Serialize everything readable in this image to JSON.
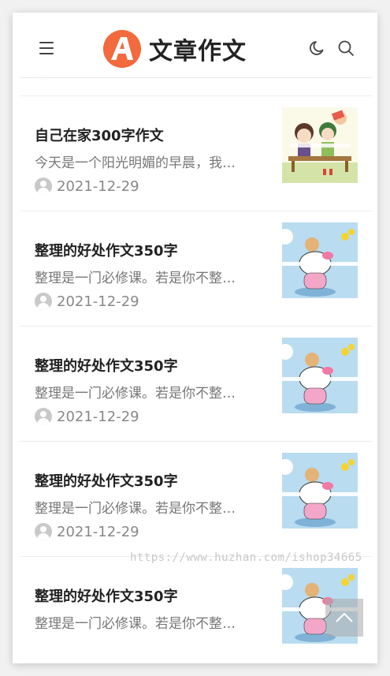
{
  "header": {
    "logo_text": "文章作文",
    "logo_letter": "A",
    "icons": [
      "menu-icon",
      "moon-icon",
      "search-icon"
    ]
  },
  "articles": [
    {
      "title": "",
      "excerpt": "",
      "date": "2021-12-29",
      "thumb": "kids-on-bench"
    },
    {
      "title": "自己在家300字作文",
      "excerpt": "今天是一个阳光明媚的早晨，我…",
      "date": "2021-12-29",
      "thumb": "kids-on-bench"
    },
    {
      "title": "整理的好处作文350字",
      "excerpt": "整理是一门必修课。若是你不整…",
      "date": "2021-12-29",
      "thumb": "hello-kitty"
    },
    {
      "title": "整理的好处作文350字",
      "excerpt": "整理是一门必修课。若是你不整…",
      "date": "2021-12-29",
      "thumb": "hello-kitty"
    },
    {
      "title": "整理的好处作文350字",
      "excerpt": "整理是一门必修课。若是你不整…",
      "date": "2021-12-29",
      "thumb": "hello-kitty"
    },
    {
      "title": "整理的好处作文350字",
      "excerpt": "整理是一门必修课。若是你不整…",
      "date": "",
      "thumb": "hello-kitty"
    }
  ],
  "watermark": "https://www.huzhan.com/ishop34665",
  "colors": {
    "accent": "#f26a3d",
    "text": "#222222",
    "muted": "#777777"
  }
}
